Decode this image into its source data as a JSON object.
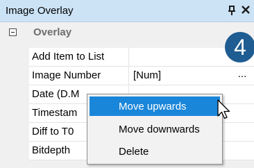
{
  "window": {
    "title": "Image Overlay",
    "pin_icon": "pin-icon",
    "close_icon": "close-icon"
  },
  "badge": {
    "label": "4",
    "color": "#1e5c91"
  },
  "grid": {
    "category": {
      "label": "Overlay",
      "expanded": true
    },
    "rows": [
      {
        "name": "Add Item to List",
        "value": ""
      },
      {
        "name": "Image Number",
        "value": "[Num]",
        "button": "..."
      },
      {
        "name": "Date (D.M",
        "value": ""
      },
      {
        "name": "Timestam",
        "value": ""
      },
      {
        "name": "Diff to T0",
        "value": ""
      },
      {
        "name": "Bitdepth",
        "value": ""
      }
    ]
  },
  "context_menu": {
    "items": [
      {
        "label": "Move upwards",
        "highlighted": true
      },
      {
        "label": "Move downwards",
        "highlighted": false
      },
      {
        "label": "Delete",
        "highlighted": false
      }
    ],
    "highlight_color": "#1a86d9"
  }
}
